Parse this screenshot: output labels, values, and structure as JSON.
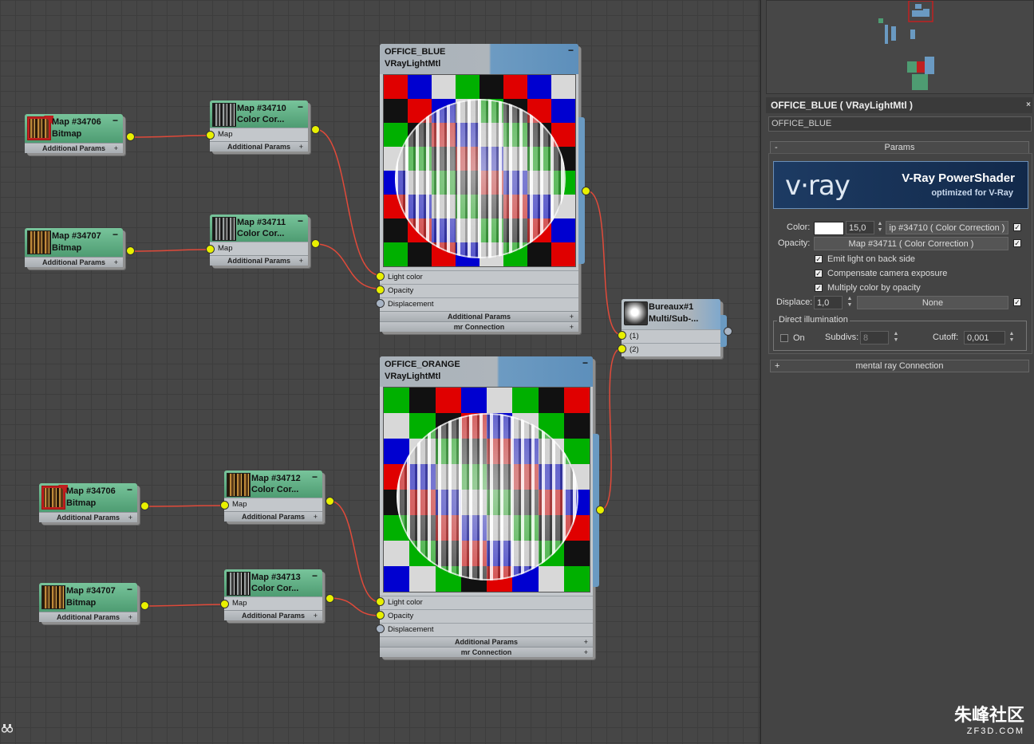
{
  "graph": {
    "map_nodes": [
      {
        "id": "n1",
        "title": "Map #34706",
        "subtitle": "Bitmap",
        "sub_label": "Additional Params",
        "plus": "+",
        "thumb": "orange",
        "marker": true
      },
      {
        "id": "n2",
        "title": "Map #34707",
        "subtitle": "Bitmap",
        "sub_label": "Additional Params",
        "plus": "+",
        "thumb": "orange",
        "marker": false
      },
      {
        "id": "n3",
        "title": "Map #34710",
        "subtitle": "Color Cor...",
        "row_label": "Map",
        "sub_label": "Additional Params",
        "plus": "+",
        "thumb": "gray"
      },
      {
        "id": "n4",
        "title": "Map #34711",
        "subtitle": "Color Cor...",
        "row_label": "Map",
        "sub_label": "Additional Params",
        "plus": "+",
        "thumb": "gray"
      },
      {
        "id": "n5",
        "title": "Map #34706",
        "subtitle": "Bitmap",
        "sub_label": "Additional Params",
        "plus": "+",
        "thumb": "orange",
        "marker": true
      },
      {
        "id": "n6",
        "title": "Map #34707",
        "subtitle": "Bitmap",
        "sub_label": "Additional Params",
        "plus": "+",
        "thumb": "orange",
        "marker": false
      },
      {
        "id": "n7",
        "title": "Map #34712",
        "subtitle": "Color Cor...",
        "row_label": "Map",
        "sub_label": "Additional Params",
        "plus": "+",
        "thumb": "orange"
      },
      {
        "id": "n8",
        "title": "Map #34713",
        "subtitle": "Color Cor...",
        "row_label": "Map",
        "sub_label": "Additional Params",
        "plus": "+",
        "thumb": "gray"
      }
    ],
    "material_nodes": [
      {
        "id": "m1",
        "title": "OFFICE_BLUE",
        "subtitle": "VRayLightMtl",
        "rows": [
          "Light color",
          "Opacity",
          "Displacement"
        ],
        "subs": [
          "Additional Params",
          "mr Connection"
        ]
      },
      {
        "id": "m2",
        "title": "OFFICE_ORANGE",
        "subtitle": "VRayLightMtl",
        "rows": [
          "Light color",
          "Opacity",
          "Displacement"
        ],
        "subs": [
          "Additional Params",
          "mr Connection"
        ]
      }
    ],
    "multi_node": {
      "title": "Bureaux#1",
      "subtitle": "Multi/Sub-...",
      "rows": [
        "(1)",
        "(2)"
      ]
    },
    "collapse_symbol": "−",
    "binoculars_icon": "binoculars-icon",
    "checker_colors": [
      "#e00000",
      "#00b000",
      "#0000d0",
      "#111111",
      "#d8d8d8"
    ],
    "wire_color": "#e04a3a",
    "socket_color": "#e8f000"
  },
  "panel": {
    "title": "OFFICE_BLUE  ( VRayLightMtl )",
    "close": "×",
    "name_field": "OFFICE_BLUE",
    "params_rollout": "Params",
    "params_symbol": "-",
    "banner": {
      "logo": "v·ray",
      "title": "V-Ray PowerShader",
      "subtitle": "optimized for V-Ray"
    },
    "color_label": "Color:",
    "color_value": "15,0",
    "color_map": "ip #34710  ( Color Correction )",
    "opacity_label": "Opacity:",
    "opacity_map": "Map #34711  ( Color Correction )",
    "checks": [
      {
        "label": "Emit light on back side",
        "checked": true
      },
      {
        "label": "Compensate camera exposure",
        "checked": true
      },
      {
        "label": "Multiply color by opacity",
        "checked": true
      }
    ],
    "displace_label": "Displace:",
    "displace_value": "1,0",
    "displace_map": "None",
    "direct_group": "Direct illumination",
    "on_label": "On",
    "subdivs_label": "Subdivs:",
    "subdivs_value": "8",
    "cutoff_label": "Cutoff:",
    "cutoff_value": "0,001",
    "mr_rollout": "mental ray Connection",
    "mr_symbol": "+",
    "check_mark": "✓"
  },
  "watermark": {
    "cn": "朱峰社区",
    "en": "ZF3D.COM"
  }
}
